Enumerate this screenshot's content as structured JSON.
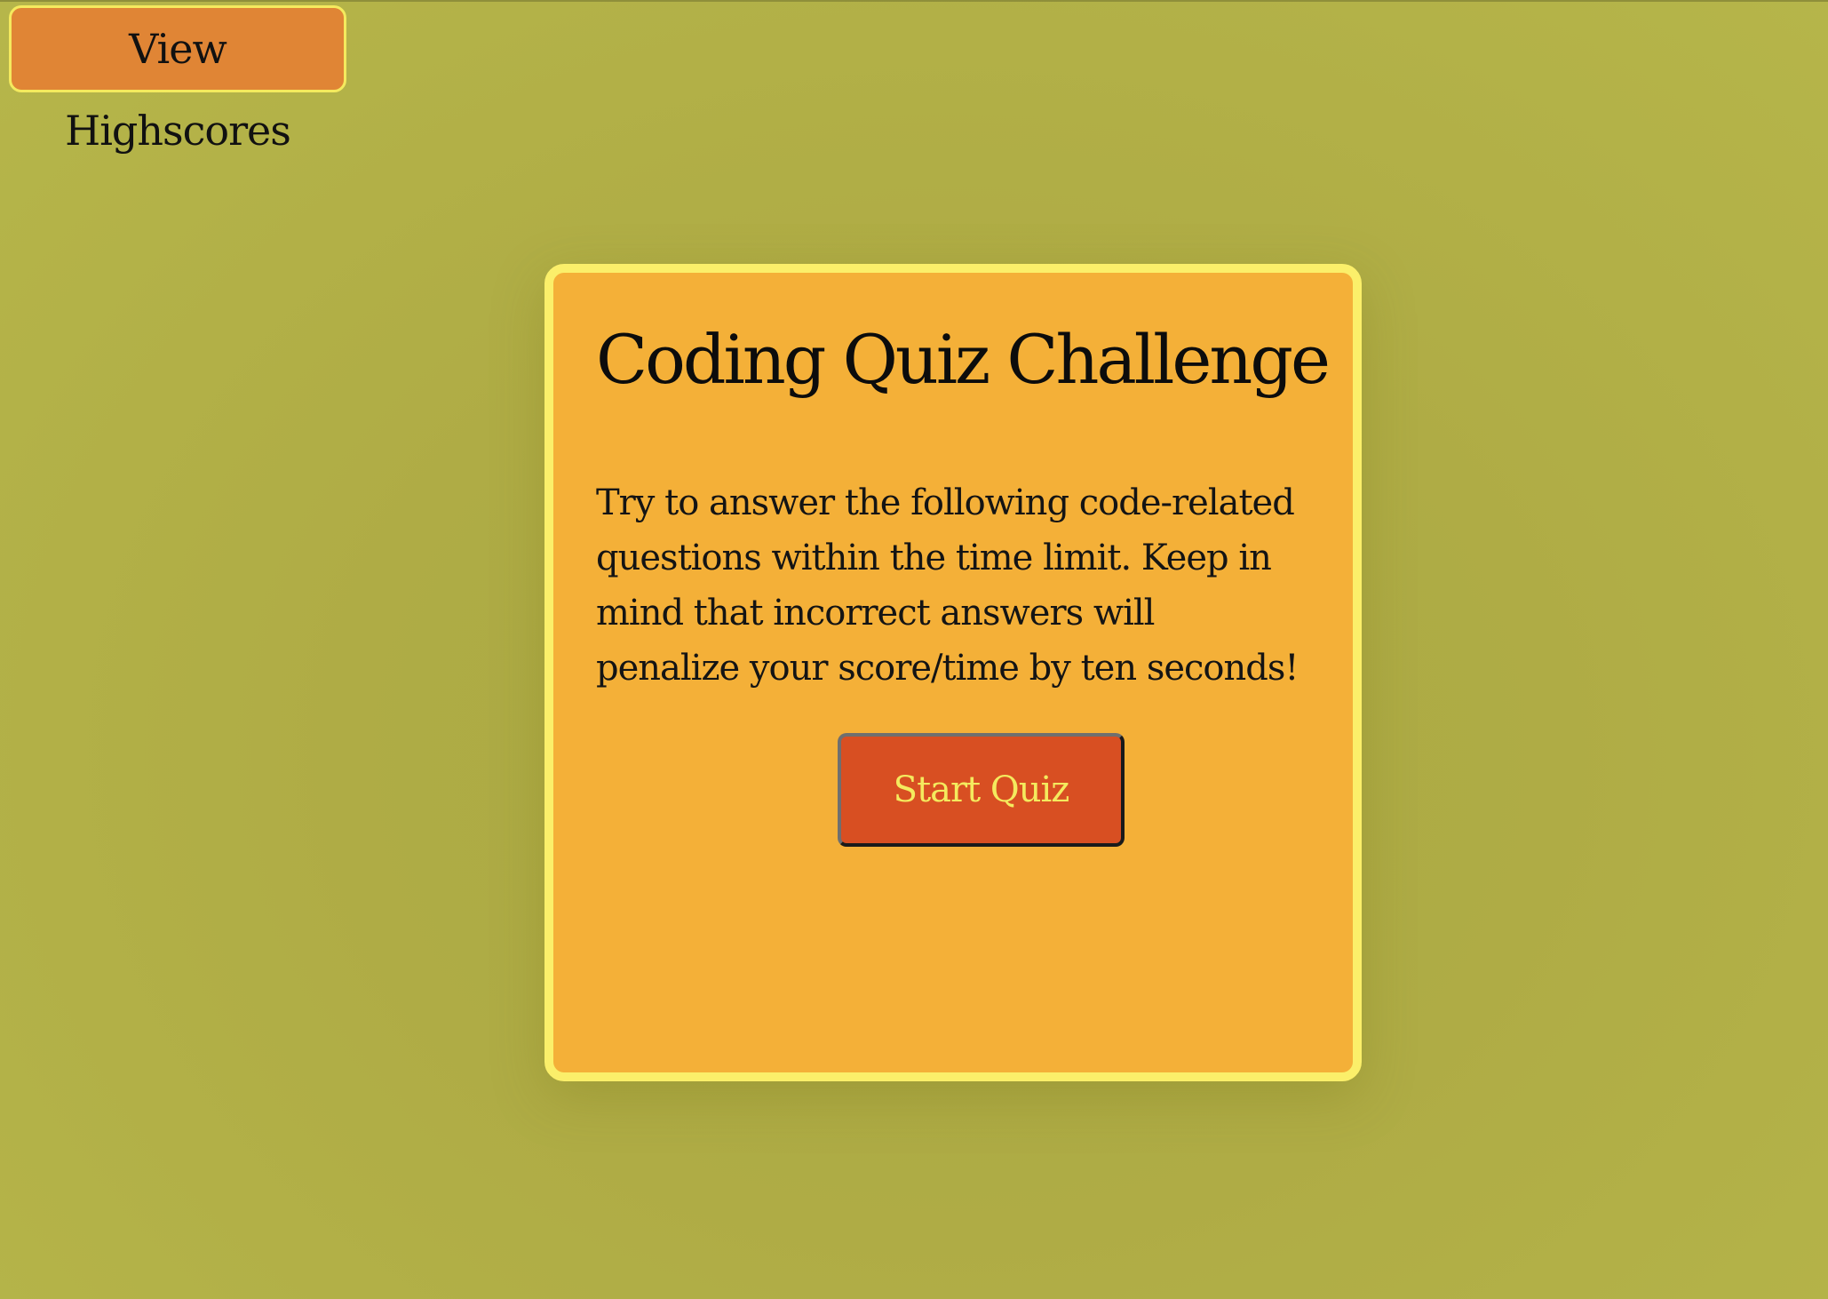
{
  "header": {
    "highscores_label": "View Highscores"
  },
  "card": {
    "title": "Coding Quiz Challenge",
    "description": "Try to answer the following code-related questions within the time limit. Keep in mind that incorrect answers will penalize your score/time by ten seconds!",
    "start_label": "Start Quiz"
  },
  "colors": {
    "background": "#b0ae46",
    "card_background": "#f4b038",
    "card_border": "#fbef6a",
    "highscores_button": "#e08535",
    "start_button": "#d84f22",
    "start_button_text": "#f4ea5e"
  }
}
